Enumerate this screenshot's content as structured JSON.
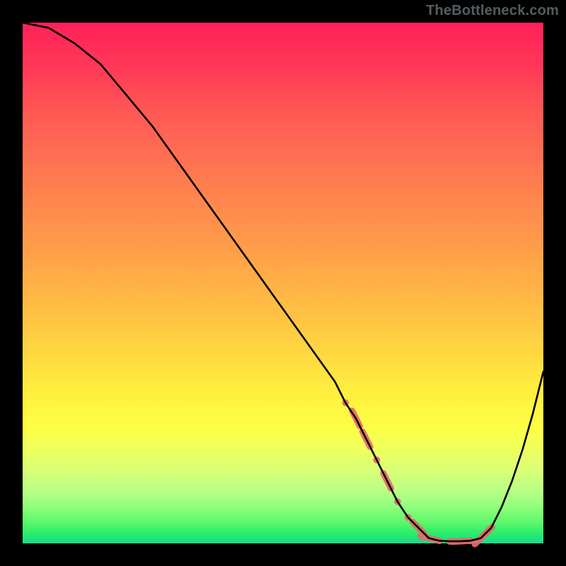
{
  "attribution": "TheBottleneck.com",
  "colors": {
    "background": "#000000",
    "curve": "#000000",
    "marker": "#e46a6a",
    "attribution_text": "#555d61"
  },
  "chart_data": {
    "type": "line",
    "title": "",
    "xlabel": "",
    "ylabel": "",
    "xlim": [
      0,
      100
    ],
    "ylim": [
      0,
      100
    ],
    "grid": false,
    "legend": false,
    "series": [
      {
        "name": "bottleneck-curve",
        "x": [
          0,
          5,
          10,
          15,
          20,
          25,
          30,
          35,
          40,
          45,
          50,
          55,
          60,
          62,
          64,
          66,
          68,
          70,
          72,
          74,
          76,
          78,
          80,
          82,
          84,
          86,
          88,
          90,
          92,
          94,
          96,
          98,
          100
        ],
        "values": [
          100,
          99,
          96,
          92,
          86,
          80,
          73,
          66,
          59,
          52,
          45,
          38,
          31,
          27,
          24,
          20,
          16,
          12,
          8,
          5,
          3,
          1,
          0.5,
          0.4,
          0.4,
          0.5,
          1,
          3,
          7,
          12,
          18,
          25,
          33
        ]
      }
    ],
    "markers": {
      "name": "highlighted-range",
      "description": "salmon dotted/dashed highlight along curve bottom",
      "x": [
        62,
        64,
        66,
        68,
        70,
        72,
        74,
        76,
        78,
        80,
        82,
        84,
        86,
        88,
        89
      ],
      "values": [
        27,
        24,
        20,
        16,
        12,
        8,
        5,
        3,
        1,
        0.5,
        0.4,
        0.4,
        0.5,
        1,
        2
      ]
    }
  }
}
